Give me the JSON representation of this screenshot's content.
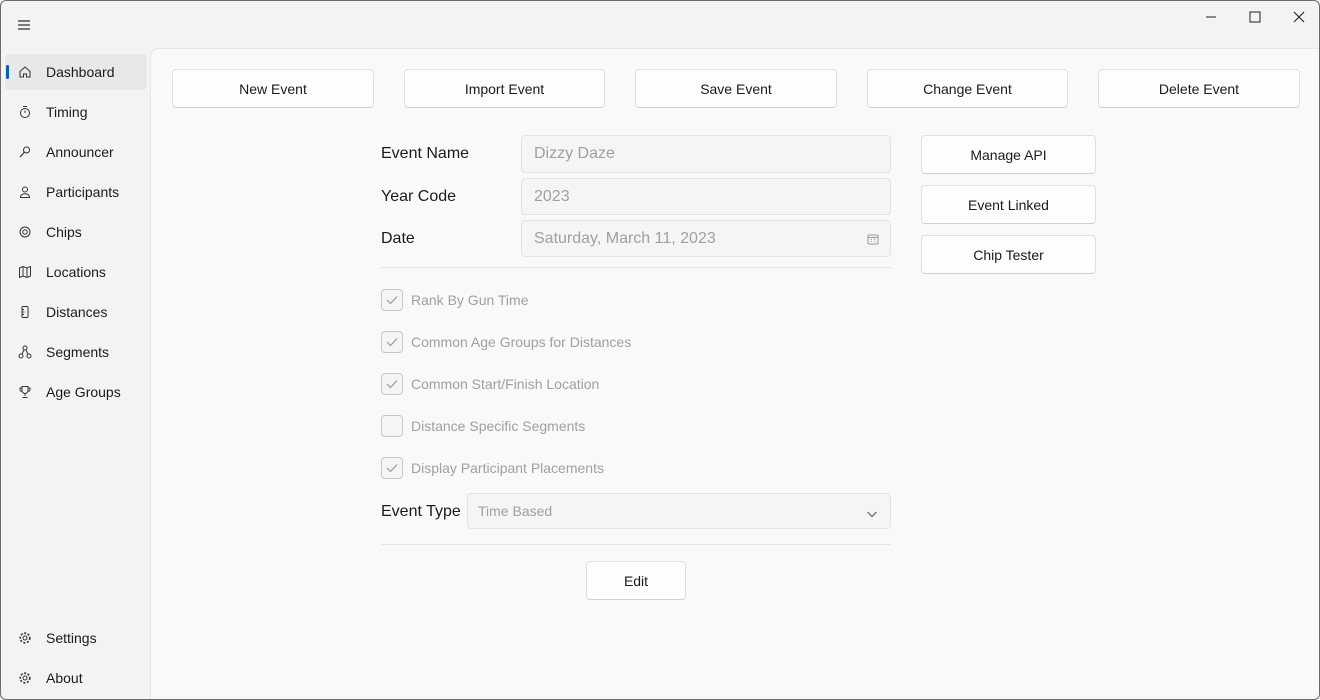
{
  "window": {
    "menu_icon": "hamburger-icon",
    "caption": {
      "minimize_icon": "minimize-icon",
      "maximize_icon": "maximize-icon",
      "close_icon": "close-icon"
    }
  },
  "sidebar": {
    "items": [
      {
        "label": "Dashboard",
        "icon": "home-icon",
        "selected": true
      },
      {
        "label": "Timing",
        "icon": "stopwatch-icon"
      },
      {
        "label": "Announcer",
        "icon": "microphone-icon"
      },
      {
        "label": "Participants",
        "icon": "person-icon"
      },
      {
        "label": "Chips",
        "icon": "chip-icon"
      },
      {
        "label": "Locations",
        "icon": "map-icon"
      },
      {
        "label": "Distances",
        "icon": "ruler-icon"
      },
      {
        "label": "Segments",
        "icon": "segments-icon"
      },
      {
        "label": "Age Groups",
        "icon": "trophy-icon"
      }
    ],
    "footer_items": [
      {
        "label": "Settings",
        "icon": "gear-icon"
      },
      {
        "label": "About",
        "icon": "info-gear-icon"
      }
    ]
  },
  "toolbar": {
    "new_event": "New Event",
    "import_event": "Import Event",
    "save_event": "Save Event",
    "change_event": "Change Event",
    "delete_event": "Delete Event"
  },
  "form": {
    "event_name_label": "Event Name",
    "event_name_value": "Dizzy Daze",
    "year_code_label": "Year Code",
    "year_code_value": "2023",
    "date_label": "Date",
    "date_value": "Saturday, March 11, 2023",
    "checkboxes": [
      {
        "label": "Rank By Gun Time",
        "checked": true
      },
      {
        "label": "Common Age Groups for Distances",
        "checked": true
      },
      {
        "label": "Common Start/Finish Location",
        "checked": true
      },
      {
        "label": "Distance Specific Segments",
        "checked": false
      },
      {
        "label": "Display Participant Placements",
        "checked": true
      }
    ],
    "event_type_label": "Event Type",
    "event_type_value": "Time Based",
    "edit_button": "Edit"
  },
  "side_actions": {
    "manage_api": "Manage API",
    "event_linked": "Event Linked",
    "chip_tester": "Chip Tester"
  },
  "colors": {
    "accent": "#005fb8",
    "disabled_text": "#a0a0a0"
  }
}
